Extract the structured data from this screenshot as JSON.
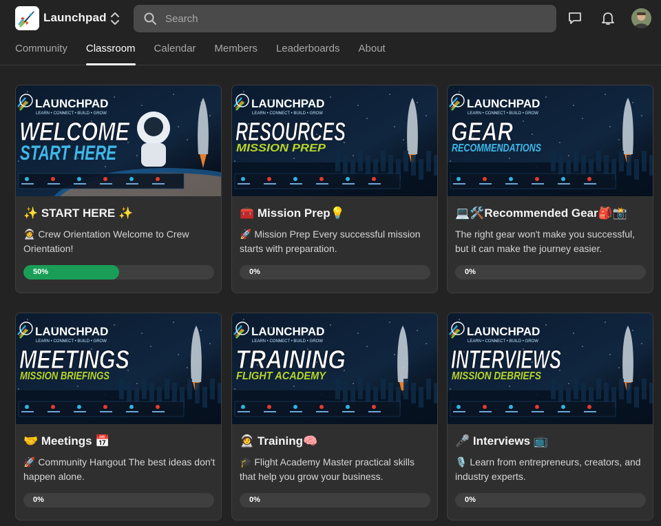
{
  "app": {
    "name": "Launchpad",
    "switcher_icon": "chevron-up-down-icon",
    "logo_icon": "rocket-logo-icon"
  },
  "search": {
    "placeholder": "Search"
  },
  "header_icons": [
    "chat-icon",
    "bell-icon"
  ],
  "tabs": [
    {
      "label": "Community",
      "active": false
    },
    {
      "label": "Classroom",
      "active": true
    },
    {
      "label": "Calendar",
      "active": false
    },
    {
      "label": "Members",
      "active": false
    },
    {
      "label": "Leaderboards",
      "active": false
    },
    {
      "label": "About",
      "active": false
    }
  ],
  "banner_brand": {
    "name": "LAUNCHPAD",
    "tagline": "LEARN • CONNECT • BUILD • GROW"
  },
  "courses": [
    {
      "title": "✨ START HERE ✨",
      "description": "🧑‍🚀 Crew Orientation Welcome to Crew Orientation!",
      "progress": 50,
      "progress_label": "50%",
      "banner": {
        "line1": "WELCOME",
        "line2": "START HERE",
        "accent": "#3fb7e8"
      }
    },
    {
      "title": "🧰 Mission Prep💡",
      "description": "🚀 Mission Prep Every successful mission starts with preparation.",
      "progress": 0,
      "progress_label": "0%",
      "banner": {
        "line1": "RESOURCES",
        "line2": "MISSION PREP",
        "accent": "#b8d42a"
      }
    },
    {
      "title": "💻🛠️Recommended Gear🎒📸",
      "description": "The right gear won't make you successful, but it can make the journey easier.",
      "progress": 0,
      "progress_label": "0%",
      "banner": {
        "line1": "GEAR",
        "line2": "RECOMMENDATIONS",
        "accent": "#3fb7e8"
      }
    },
    {
      "title": "🤝 Meetings 📅",
      "description": "🚀 Community Hangout The best ideas don't happen alone.",
      "progress": 0,
      "progress_label": "0%",
      "banner": {
        "line1": "MEETINGS",
        "line2": "MISSION BRIEFINGS",
        "accent": "#b8d42a"
      }
    },
    {
      "title": "🧑‍🚀 Training🧠",
      "description": "🎓 Flight Academy Master practical skills that help you grow your business.",
      "progress": 0,
      "progress_label": "0%",
      "banner": {
        "line1": "TRAINING",
        "line2": "FLIGHT ACADEMY",
        "accent": "#b8d42a"
      }
    },
    {
      "title": "🎤 Interviews 📺",
      "description": "🎙️ Learn from entrepreneurs, creators, and industry experts.",
      "progress": 0,
      "progress_label": "0%",
      "banner": {
        "line1": "INTERVIEWS",
        "line2": "MISSION DEBRIEFS",
        "accent": "#b8d42a"
      }
    }
  ],
  "colors": {
    "background": "#232323",
    "card": "#2f2f2f",
    "progress_fill": "#1a9e57",
    "progress_track": "#3f3f3f"
  }
}
